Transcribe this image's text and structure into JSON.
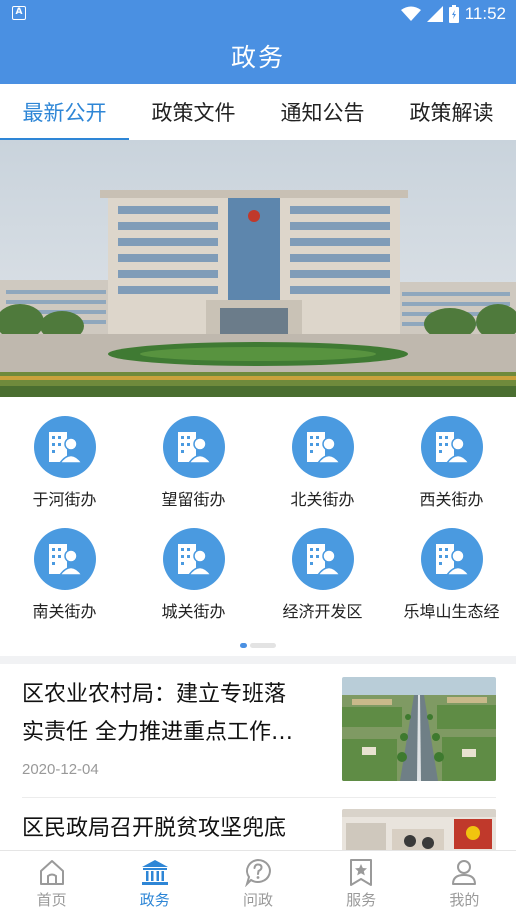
{
  "status_bar": {
    "time": "11:52",
    "notification_letter": "A"
  },
  "header": {
    "title": "政务"
  },
  "tabs": [
    {
      "label": "最新公开",
      "active": true
    },
    {
      "label": "政策文件",
      "active": false
    },
    {
      "label": "通知公告",
      "active": false
    },
    {
      "label": "政策解读",
      "active": false
    }
  ],
  "banner": {
    "image": "government-building-photo"
  },
  "districts": [
    {
      "label": "于河街办",
      "icon": "office-person-icon"
    },
    {
      "label": "望留街办",
      "icon": "office-person-icon"
    },
    {
      "label": "北关街办",
      "icon": "office-person-icon"
    },
    {
      "label": "西关街办",
      "icon": "office-person-icon"
    },
    {
      "label": "南关街办",
      "icon": "office-person-icon"
    },
    {
      "label": "城关街办",
      "icon": "office-person-icon"
    },
    {
      "label": "经济开发区",
      "icon": "office-person-icon"
    },
    {
      "label": "乐埠山生态经",
      "icon": "office-person-icon"
    }
  ],
  "pager": {
    "pages": 2,
    "current": 1
  },
  "news": [
    {
      "title_line1": "区农业农村局：建立专班落",
      "title_line2": "实责任 全力推进重点工作…",
      "date": "2020-12-04",
      "thumb": "rural-road-aerial-photo"
    },
    {
      "title_line1": "区民政局召开脱贫攻坚兜底",
      "title_line2": "",
      "date": "",
      "thumb": "meeting-room-photo"
    }
  ],
  "bottom_nav": [
    {
      "label": "首页",
      "icon": "home-icon",
      "active": false
    },
    {
      "label": "政务",
      "icon": "government-building-icon",
      "active": true
    },
    {
      "label": "问政",
      "icon": "question-bubble-icon",
      "active": false
    },
    {
      "label": "服务",
      "icon": "star-bookmark-icon",
      "active": false
    },
    {
      "label": "我的",
      "icon": "user-icon",
      "active": false
    }
  ],
  "colors": {
    "primary": "#4a90e2",
    "active_text": "#2e86d6",
    "icon_circle": "#4a9ae0"
  }
}
